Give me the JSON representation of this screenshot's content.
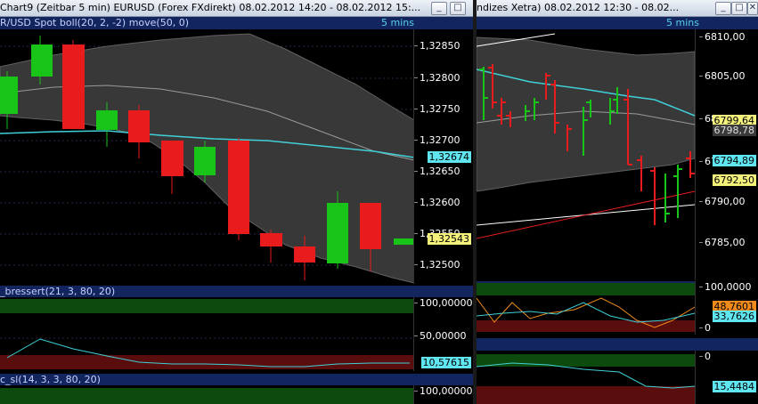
{
  "left_window": {
    "title": "Chart9 (Zeitbar 5 min)  EURUSD (Forex FXdirekt) 08.02.2012 14:20 - 08.02.2012 15:...",
    "header_label": "R/USD Spot boll(20, 2, -2) move(50, 0)",
    "interval": "5 mins",
    "price_ticks": [
      "1,32850",
      "1,32800",
      "1,32750",
      "1,32700",
      "1,32650",
      "1,32600",
      "1,32550",
      "1,32500"
    ],
    "tags": {
      "ma": "1,32674",
      "last": "1,32543"
    },
    "ind1_header": "_bressert(21, 3, 80, 20)",
    "ind1_ticks": [
      "100,00000",
      "50,00000"
    ],
    "ind1_tag": "10,57615",
    "ind2_header": "c_sl(14, 3, 3, 80, 20)",
    "ind2_ticks": [
      "100,00000"
    ],
    "buttons": {
      "min": "_",
      "max": "□"
    }
  },
  "right_window": {
    "title": "ndizes Xetra) 08.02.2012 12:30 - 08.02...",
    "interval": "5 mins",
    "price_ticks": [
      "6810,00",
      "6805,00",
      "6800,00",
      "6795,00",
      "6790,00",
      "6785,00"
    ],
    "tags": {
      "upper": "6799,64",
      "mid": "6798,78",
      "ma": "6794,89",
      "last": "6792,50"
    },
    "ind1_ticks": [
      "100,0000",
      "0"
    ],
    "ind1_tags": {
      "a": "48,7601",
      "b": "33,7626"
    },
    "ind2_ticks": [
      "0"
    ],
    "ind2_tag": "15,4484",
    "buttons": {
      "min": "_",
      "max": "□",
      "close": "✕"
    }
  },
  "colors": {
    "bull": "#19c419",
    "bear": "#e81c1c",
    "band": "#3a3a3a",
    "ma": "#3fd0d8",
    "green_zone": "#0d4a0d",
    "red_zone": "#5a0d0d",
    "tag_cyan": "#5fe6f0",
    "tag_yellow": "#f4f27a"
  }
}
